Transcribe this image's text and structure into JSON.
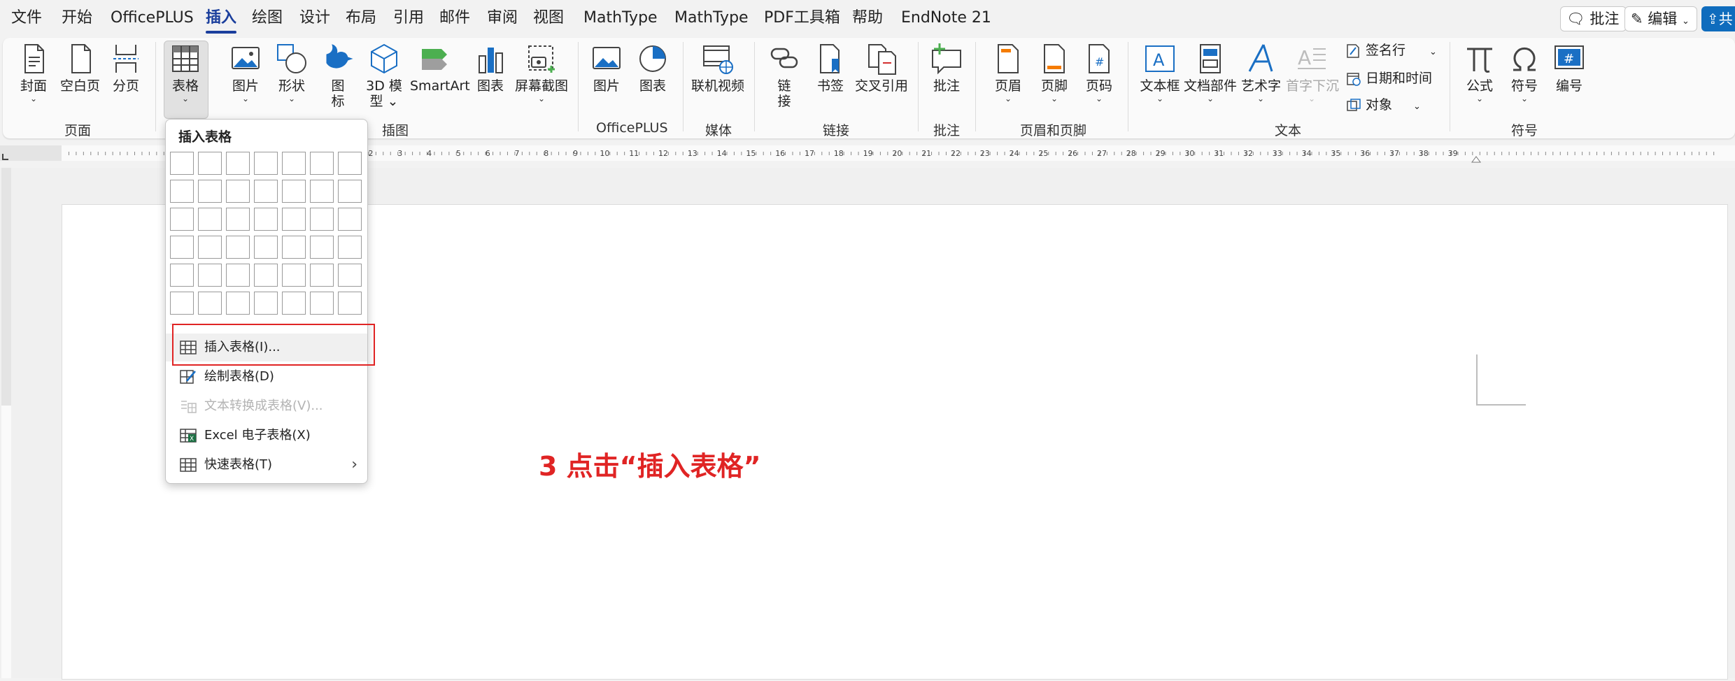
{
  "menubar": {
    "items": [
      "文件",
      "开始",
      "OfficePLUS",
      "插入",
      "绘图",
      "设计",
      "布局",
      "引用",
      "邮件",
      "审阅",
      "视图",
      "MathType",
      "MathType",
      "PDF工具箱",
      "帮助",
      "EndNote 21"
    ],
    "active_index": 3,
    "comment_button": "批注",
    "edit_button": "编辑",
    "share_button": "共"
  },
  "ribbon": {
    "buttons": {
      "cover": "封面",
      "blank_page": "空白页",
      "page_break": "分页",
      "table": "表格",
      "picture": "图片",
      "shapes": "形状",
      "icons_line1": "图",
      "icons_line2": "标",
      "model3d_line1": "3D 模",
      "model3d_line2": "型",
      "smartart": "SmartArt",
      "chart": "图表",
      "screenshot": "屏幕截图",
      "op_picture": "图片",
      "op_chart": "图表",
      "online_video": "联机视频",
      "link_line1": "链",
      "link_line2": "接",
      "bookmark": "书签",
      "cross_ref": "交叉引用",
      "comment": "批注",
      "header": "页眉",
      "footer": "页脚",
      "page_number": "页码",
      "textbox": "文本框",
      "quick_parts": "文档部件",
      "wordart": "艺术字",
      "dropcap": "首字下沉",
      "signature_line": "签名行",
      "date_time": "日期和时间",
      "object": "对象",
      "equation": "公式",
      "symbol": "符号",
      "number": "编号"
    },
    "groups": {
      "pages": "页面",
      "illustrations": "插图",
      "officeplus": "OfficePLUS",
      "media": "媒体",
      "links": "链接",
      "comments": "批注",
      "header_footer": "页眉和页脚",
      "text": "文本",
      "symbols": "符号"
    }
  },
  "ruler": {
    "numbers": [
      "2",
      "3",
      "4",
      "5",
      "6",
      "7",
      "8",
      "9",
      "10",
      "11",
      "12",
      "13",
      "14",
      "15",
      "16",
      "17",
      "18",
      "19",
      "20",
      "21",
      "22",
      "23",
      "24",
      "25",
      "26",
      "27",
      "28",
      "29",
      "30",
      "31",
      "32",
      "33",
      "34",
      "35",
      "36",
      "37",
      "38",
      "39"
    ]
  },
  "dropdown": {
    "title": "插入表格",
    "grid_cols": 7,
    "grid_rows": 6,
    "items": [
      {
        "label": "插入表格(I)...",
        "icon": "table-grid-icon",
        "disabled": false
      },
      {
        "label": "绘制表格(D)",
        "icon": "draw-table-icon",
        "disabled": false
      },
      {
        "label": "文本转换成表格(V)...",
        "icon": "convert-text-icon",
        "disabled": true
      },
      {
        "label": "Excel 电子表格(X)",
        "icon": "excel-icon",
        "disabled": false
      },
      {
        "label": "快速表格(T)",
        "icon": "quick-table-icon",
        "disabled": false
      }
    ]
  },
  "annotation": "3 点击“插入表格”",
  "colors": {
    "accent": "#1a3e9c",
    "annotation_red": "#e02424",
    "share_blue": "#0f6cbd"
  }
}
